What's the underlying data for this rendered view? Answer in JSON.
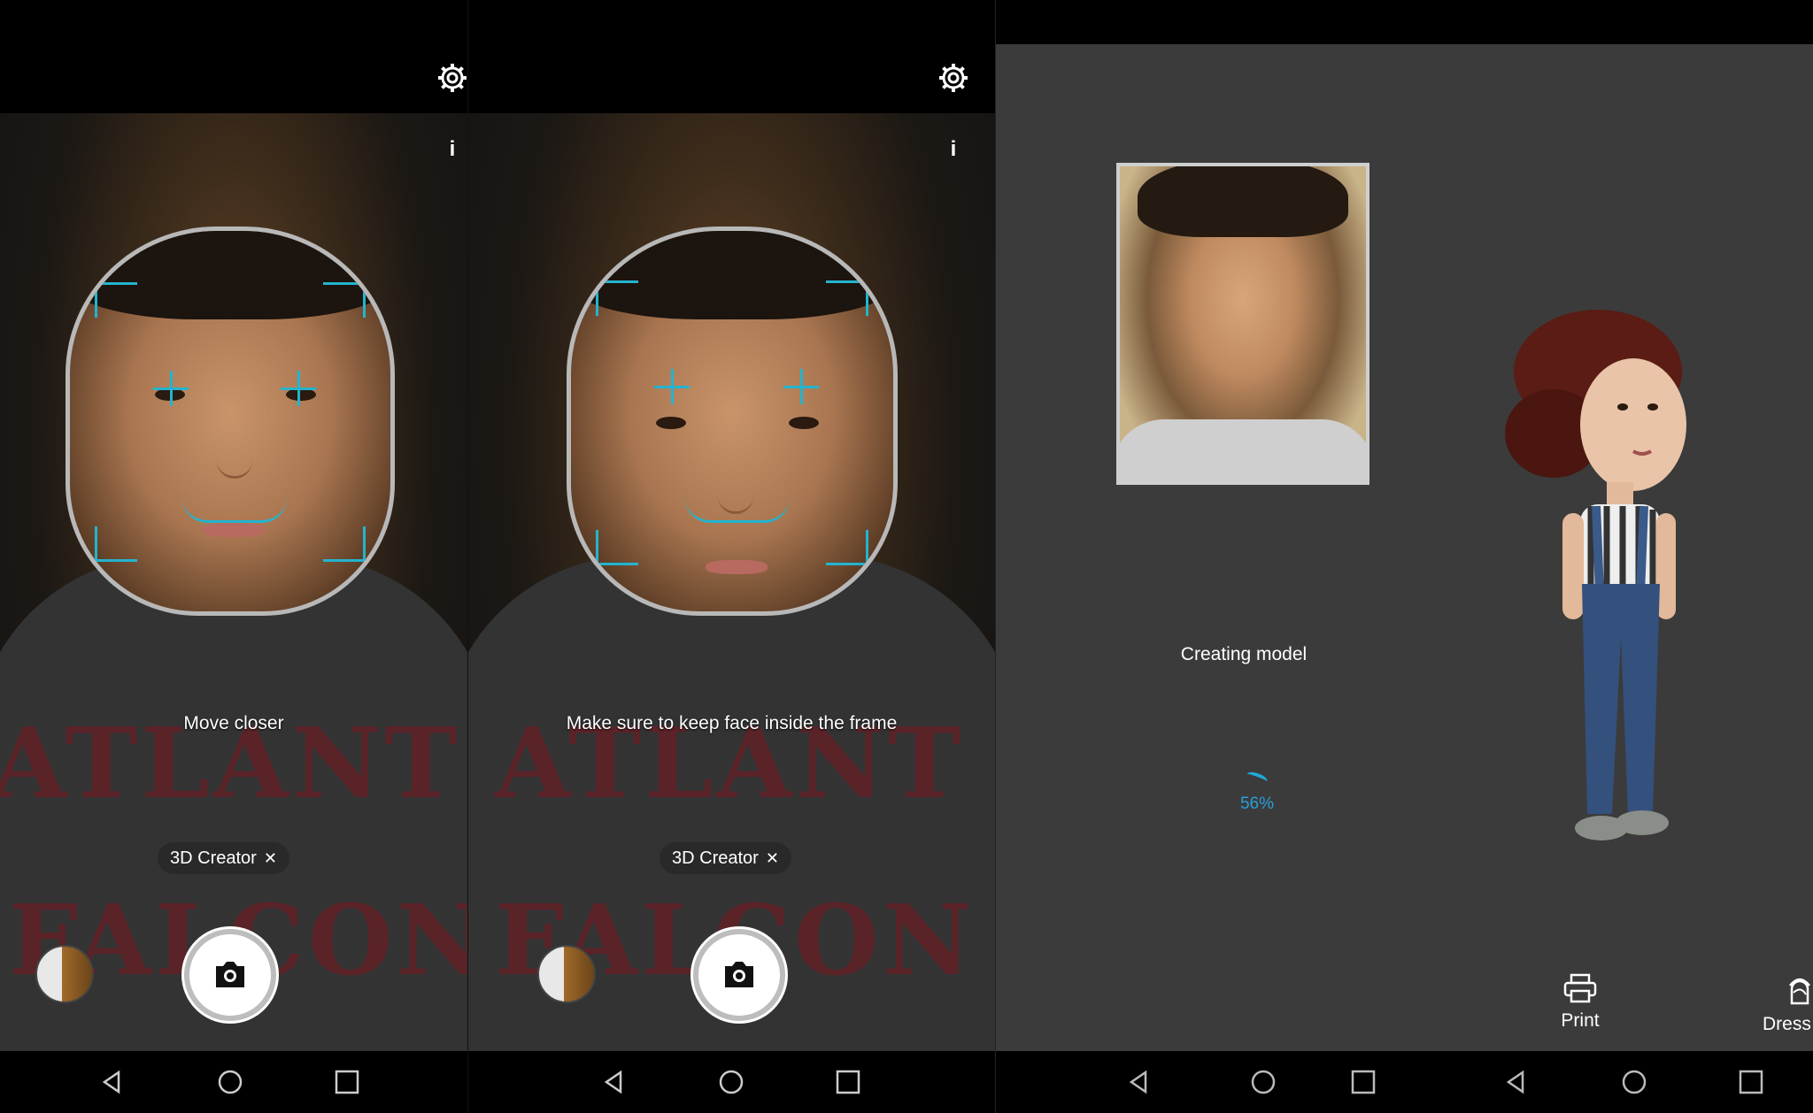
{
  "screens": [
    {
      "hint": "Move closer",
      "mode_chip": {
        "label": "3D Creator",
        "close": "✕"
      },
      "icons": {
        "settings": "gear-icon",
        "info": "i"
      }
    },
    {
      "hint": "Make sure to keep face inside the frame",
      "mode_chip": {
        "label": "3D Creator",
        "close": "✕"
      },
      "icons": {
        "settings": "gear-icon",
        "info": "i"
      }
    }
  ],
  "result": {
    "status": "Creating model",
    "progress_label": "56%",
    "progress": 56,
    "actions": [
      {
        "label": "Print",
        "icon": "printer-icon"
      },
      {
        "label": "Dress up",
        "icon": "dress-up-icon"
      }
    ]
  },
  "shirt_print": {
    "line1": "ATLANT",
    "line2": "FALCON"
  },
  "colors": {
    "accent": "#23b4cf",
    "progress": "#2a9fd8",
    "result_bg": "#3b3b3b"
  }
}
